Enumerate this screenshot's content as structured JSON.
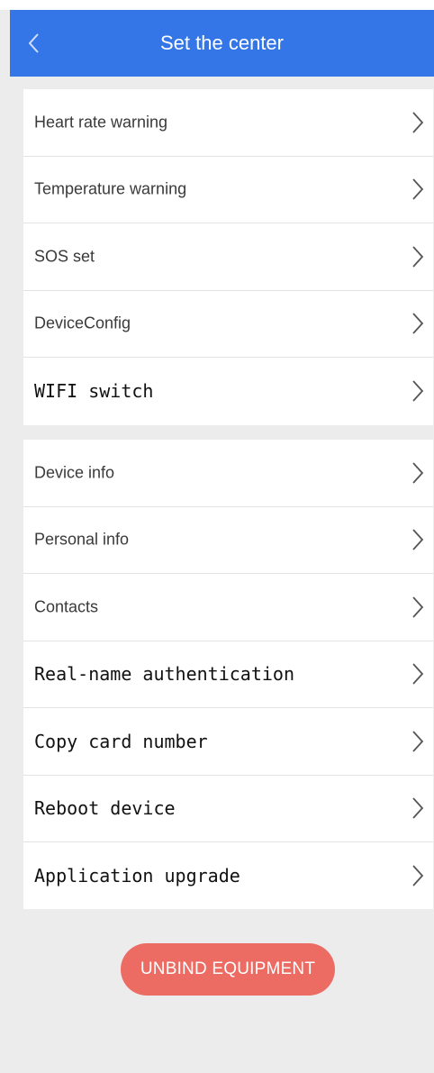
{
  "header": {
    "title": "Set the center",
    "back_icon": "chevron-left-icon"
  },
  "group_1": [
    {
      "id": "heart-rate-warning",
      "label": "Heart rate warning"
    },
    {
      "id": "temperature-warning",
      "label": "Temperature warning"
    },
    {
      "id": "sos-set",
      "label": "SOS set"
    },
    {
      "id": "device-config",
      "label": "DeviceConfig"
    },
    {
      "id": "wifi-switch",
      "label": "WIFI switch"
    }
  ],
  "group_2": [
    {
      "id": "device-info",
      "label": "Device info"
    },
    {
      "id": "personal-info",
      "label": "Personal info"
    },
    {
      "id": "contacts",
      "label": "Contacts"
    },
    {
      "id": "real-name-authentication",
      "label": "Real-name authentication"
    },
    {
      "id": "copy-card-number",
      "label": "Copy card number"
    },
    {
      "id": "reboot-device",
      "label": "Reboot device"
    },
    {
      "id": "application-upgrade",
      "label": "Application upgrade"
    }
  ],
  "unbind_button": {
    "label": "UNBIND EQUIPMENT"
  },
  "colors": {
    "header_bg": "#3476e8",
    "page_bg": "#ececec",
    "unbind_bg": "#ec6c64"
  }
}
